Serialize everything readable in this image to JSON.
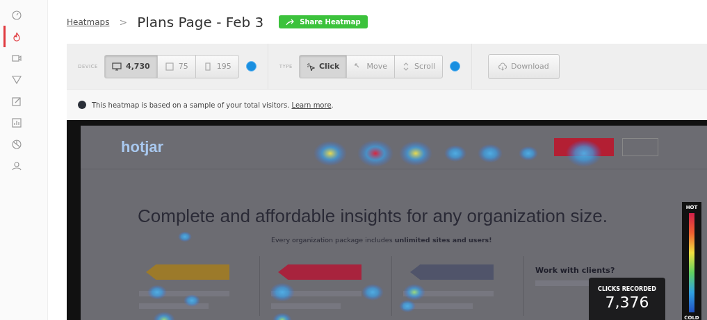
{
  "sidebar": {
    "items": [
      {
        "selected": false
      },
      {
        "selected": true
      },
      {
        "selected": false
      },
      {
        "selected": false
      },
      {
        "selected": false
      },
      {
        "selected": false
      },
      {
        "selected": false
      },
      {
        "selected": false
      }
    ]
  },
  "breadcrumb": {
    "parent": "Heatmaps",
    "separator": ">",
    "title": "Plans Page - Feb 3"
  },
  "share_button": "Share Heatmap",
  "toolbar": {
    "device_label": "DEVICE",
    "devices": [
      {
        "count": "4,730",
        "selected": true
      },
      {
        "count": "75",
        "selected": false
      },
      {
        "count": "195",
        "selected": false
      }
    ],
    "type_label": "TYPE",
    "types": [
      {
        "label": "Click",
        "selected": true
      },
      {
        "label": "Move",
        "selected": false
      },
      {
        "label": "Scroll",
        "selected": false
      }
    ],
    "download_button": "Download"
  },
  "notice": {
    "text": "This heatmap is based on a sample of your total visitors.",
    "link": "Learn more",
    "end": "."
  },
  "heatmap": {
    "logo": "hotjar",
    "headline": "Complete and affordable insights for any organization size.",
    "subline": "Every organization package includes **unlimited sites and users!**",
    "side_heading": "Work with clients?",
    "legend": {
      "top": "HOT",
      "bottom": "COLD"
    },
    "clicks": {
      "label": "CLICKS RECORDED",
      "value": "7,376"
    }
  }
}
